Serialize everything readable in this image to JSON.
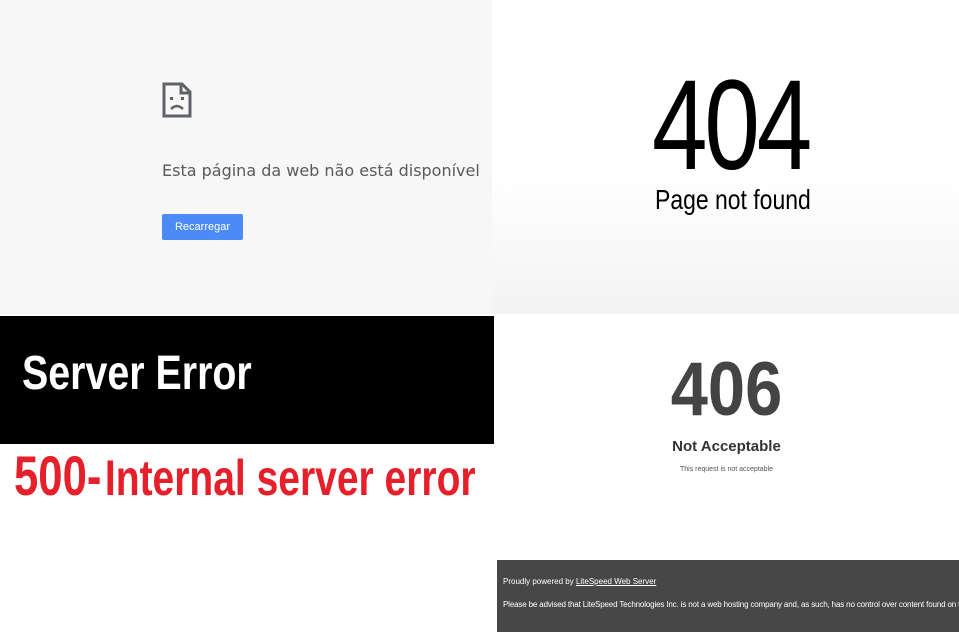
{
  "chrome_offline": {
    "icon": "sad-page-icon",
    "message": "Esta página da web não está disponível",
    "reload_label": "Recarregar",
    "colors": {
      "background": "#f7f7f7",
      "button": "#4c8bf5",
      "button_text": "#ffffff"
    }
  },
  "not_found": {
    "code": "404",
    "message": "Page not found"
  },
  "server_error": {
    "title": "Server Error",
    "code": "500-",
    "message": "Internal server error",
    "colors": {
      "banner": "#000000",
      "title": "#ffffff",
      "error": "#e5202a"
    }
  },
  "not_acceptable": {
    "code": "406",
    "title": "Not Acceptable",
    "detail": "This request is not acceptable",
    "footer": {
      "powered_prefix": "Proudly powered by ",
      "powered_link": "LiteSpeed Web Server",
      "notice": "Please be advised that LiteSpeed Technologies Inc. is not a web hosting company and, as such, has no control over content found on this site."
    },
    "colors": {
      "code": "#444444",
      "footer_bg": "#474747"
    }
  }
}
